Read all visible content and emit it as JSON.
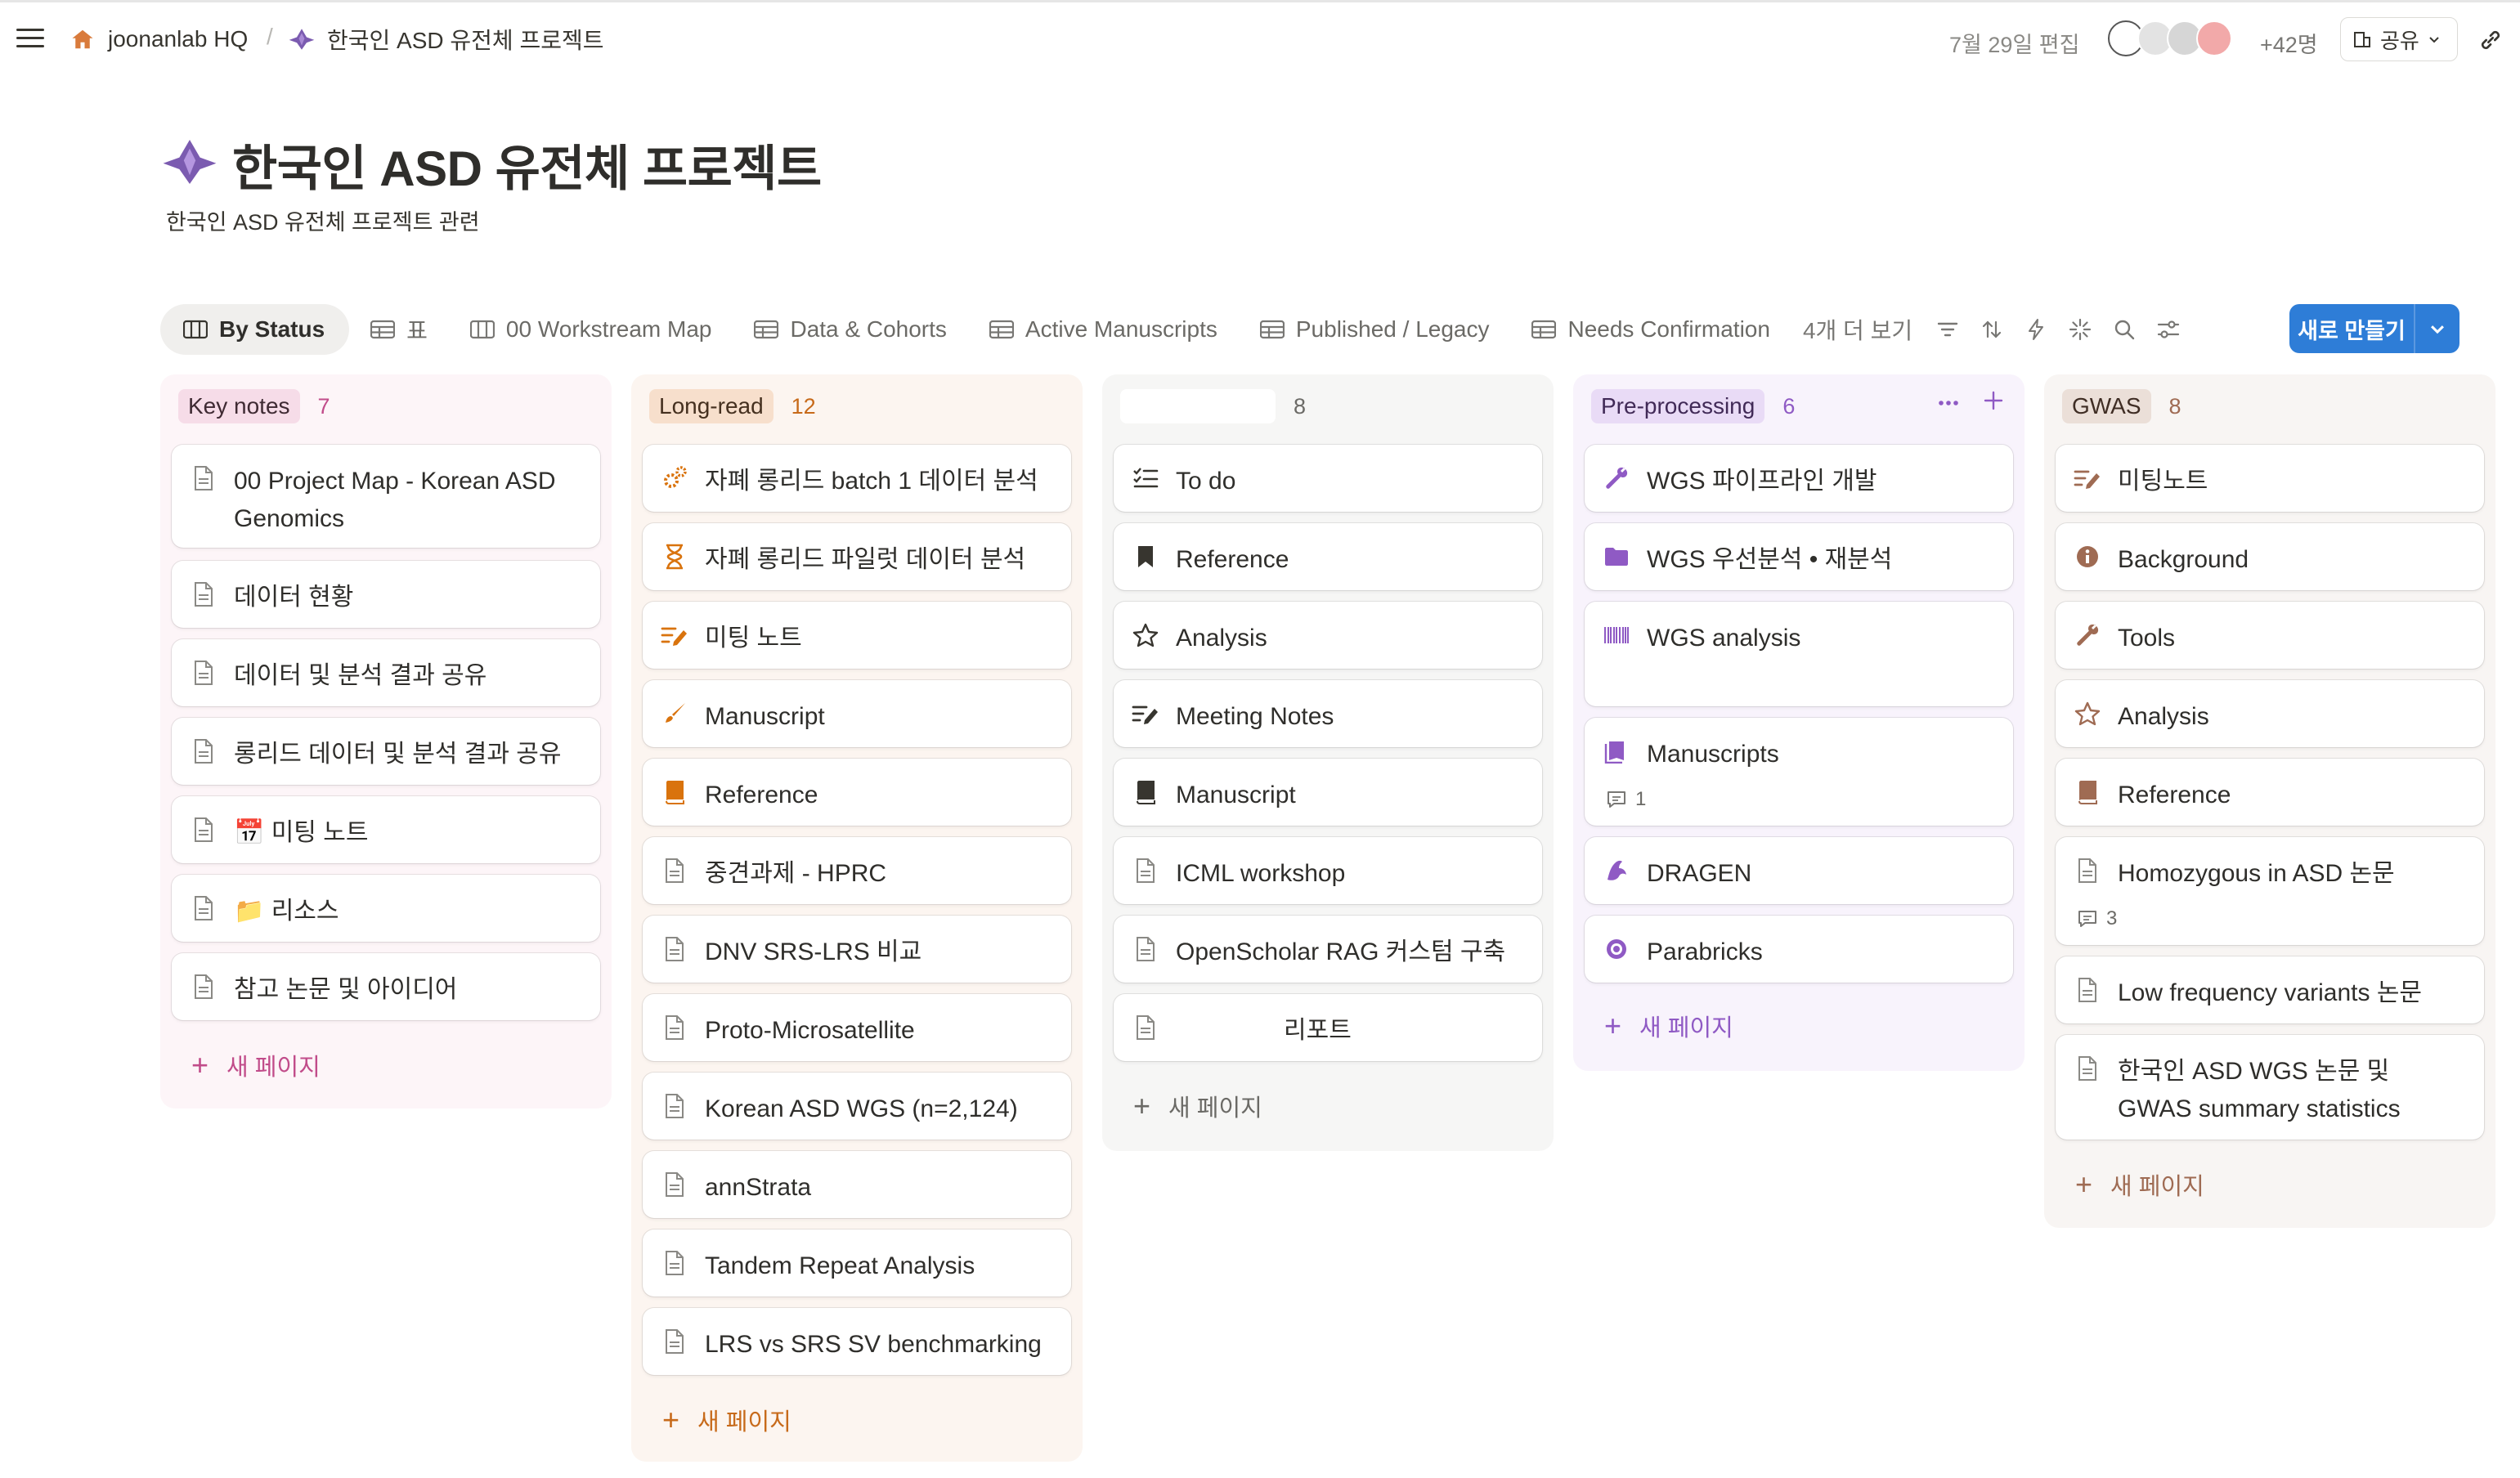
{
  "breadcrumb": {
    "workspace": "joonanlab HQ",
    "separator": "/",
    "page": "한국인 ASD 유전체 프로젝트"
  },
  "topbar": {
    "edited": "7월 29일 편집",
    "member_count": "+42명",
    "share_label": "공유"
  },
  "page": {
    "title": "한국인 ASD 유전체 프로젝트",
    "subtitle": "한국인 ASD 유전체 프로젝트 관련"
  },
  "tabs": [
    {
      "label": "By Status",
      "active": true
    },
    {
      "label": "표"
    },
    {
      "label": "00 Workstream Map"
    },
    {
      "label": "Data & Cohorts"
    },
    {
      "label": "Active Manuscripts"
    },
    {
      "label": "Published / Legacy"
    },
    {
      "label": "Needs Confirmation"
    }
  ],
  "more_views": "4개 더 보기",
  "new_button": "새로 만들기",
  "new_page_label": "새 페이지",
  "colors": {
    "accent": "#2e7dd7",
    "pink": "#c14c8a",
    "orange": "#c76a1a",
    "gray": "#787774",
    "purple": "#8f5ac4",
    "brown": "#9f6b53"
  },
  "columns": [
    {
      "name": "Key notes",
      "count": "7",
      "cards": [
        {
          "title": "00 Project Map - Korean ASD Genomics",
          "icon": "page-icon"
        },
        {
          "title": "데이터 현황",
          "icon": "page-icon"
        },
        {
          "title": "데이터 및 분석 결과 공유",
          "icon": "page-icon"
        },
        {
          "title": "롱리드 데이터 및 분석 결과 공유",
          "icon": "page-icon"
        },
        {
          "title": "📅 미팅 노트",
          "icon": "page-icon"
        },
        {
          "title": "📁 리소스",
          "icon": "page-icon"
        },
        {
          "title": "참고 논문 및 아이디어",
          "icon": "page-icon"
        }
      ]
    },
    {
      "name": "Long-read",
      "count": "12",
      "cards": [
        {
          "title": "자폐 롱리드 batch 1 데이터 분석",
          "icon": "gears-icon"
        },
        {
          "title": "자폐 롱리드 파일럿 데이터 분석",
          "icon": "hourglass-icon"
        },
        {
          "title": "미팅 노트",
          "icon": "meeting-notes-icon"
        },
        {
          "title": "Manuscript",
          "icon": "brush-icon"
        },
        {
          "title": "Reference",
          "icon": "book-icon"
        },
        {
          "title": "중견과제 - HPRC",
          "icon": "page-icon"
        },
        {
          "title": "DNV SRS-LRS 비교",
          "icon": "page-icon"
        },
        {
          "title": "Proto-Microsatellite",
          "icon": "page-icon"
        },
        {
          "title": "Korean ASD WGS (n=2,124)",
          "icon": "page-icon"
        },
        {
          "title": "annStrata",
          "icon": "page-icon"
        },
        {
          "title": "Tandem Repeat Analysis",
          "icon": "page-icon"
        },
        {
          "title": "LRS vs SRS SV benchmarking",
          "icon": "page-icon"
        }
      ]
    },
    {
      "name": "",
      "count": "8",
      "cards": [
        {
          "title": "To do",
          "icon": "checklist-icon"
        },
        {
          "title": "Reference",
          "icon": "bookmark-icon"
        },
        {
          "title": "Analysis",
          "icon": "star-icon"
        },
        {
          "title": "Meeting Notes",
          "icon": "meeting-notes-icon"
        },
        {
          "title": "Manuscript",
          "icon": "book-icon"
        },
        {
          "title": "ICML workshop",
          "icon": "page-icon"
        },
        {
          "title": "OpenScholar RAG 커스텀 구축",
          "icon": "page-icon"
        },
        {
          "title": "리포트",
          "icon": "page-icon"
        }
      ]
    },
    {
      "name": "Pre-processing",
      "count": "6",
      "cards": [
        {
          "title": "WGS 파이프라인 개발",
          "icon": "wrench-icon"
        },
        {
          "title": "WGS 우선분석 • 재분석",
          "icon": "folder-icon"
        },
        {
          "title": "WGS analysis",
          "icon": "barcode-icon"
        },
        {
          "title": "Manuscripts",
          "icon": "books-icon",
          "comments": "1"
        },
        {
          "title": "DRAGEN",
          "icon": "dragon-icon"
        },
        {
          "title": "Parabricks",
          "icon": "target-icon"
        }
      ]
    },
    {
      "name": "GWAS",
      "count": "8",
      "cards": [
        {
          "title": "미팅노트",
          "icon": "meeting-notes-icon"
        },
        {
          "title": "Background",
          "icon": "info-icon"
        },
        {
          "title": "Tools",
          "icon": "wrench-icon"
        },
        {
          "title": "Analysis",
          "icon": "star-icon"
        },
        {
          "title": "Reference",
          "icon": "book-icon"
        },
        {
          "title": "Homozygous in ASD 논문",
          "icon": "page-icon",
          "comments": "3"
        },
        {
          "title": "Low frequency variants 논문",
          "icon": "page-icon"
        },
        {
          "title": "한국인 ASD WGS 논문 및 GWAS summary statistics",
          "icon": "page-icon"
        }
      ]
    }
  ]
}
